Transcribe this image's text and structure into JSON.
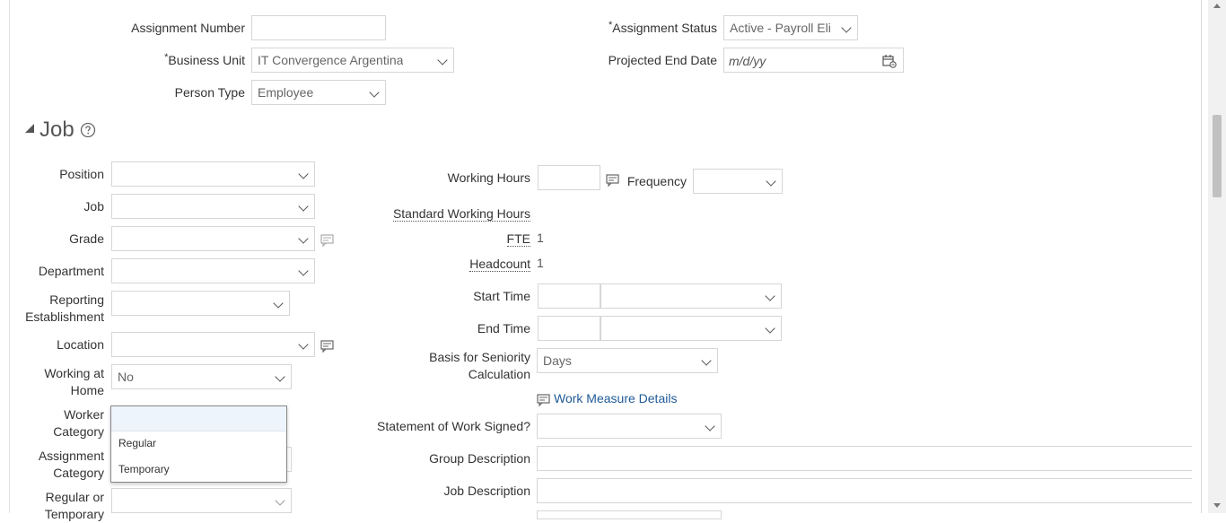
{
  "header_fields": {
    "assignment_number_label": "Assignment Number",
    "assignment_number_value": "",
    "business_unit_label": "Business Unit",
    "business_unit_value": "IT Convergence Argentina",
    "person_type_label": "Person Type",
    "person_type_value": "Employee",
    "assignment_status_label": "Assignment Status",
    "assignment_status_value": "Active - Payroll Eli",
    "projected_end_date_label": "Projected End Date",
    "projected_end_date_placeholder": "m/d/yy",
    "required_mark": "*"
  },
  "job_section": {
    "title": "Job",
    "help_icon": "help-circle-icon"
  },
  "left_fields": {
    "position": "Position",
    "job": "Job",
    "grade": "Grade",
    "department": "Department",
    "reporting_establishment_1": "Reporting",
    "reporting_establishment_2": "Establishment",
    "location": "Location",
    "working_at_home_1": "Working at",
    "working_at_home_2": "Home",
    "working_at_home_value": "No",
    "worker_category_1": "Worker",
    "worker_category_2": "Category",
    "assignment_category_1": "Assignment",
    "assignment_category_2": "Category",
    "regular_or_temporary_1": "Regular or",
    "regular_or_temporary_2": "Temporary"
  },
  "right_fields": {
    "working_hours": "Working Hours",
    "frequency": "Frequency",
    "standard_working_hours": "Standard Working Hours",
    "fte": "FTE",
    "fte_value": "1",
    "headcount": "Headcount",
    "headcount_value": "1",
    "start_time": "Start Time",
    "end_time": "End Time",
    "seniority_1": "Basis for Seniority",
    "seniority_2": "Calculation",
    "seniority_value": "Days",
    "work_measure_link": "Work Measure Details",
    "statement_of_work": "Statement of Work Signed?",
    "group_description": "Group Description",
    "job_description": "Job Description"
  },
  "worker_category_dropdown": {
    "options": [
      "",
      "Regular",
      "Temporary"
    ]
  },
  "colors": {
    "link": "#1f5a96",
    "border": "#d6d6d6",
    "highlight": "#eef4fb"
  }
}
